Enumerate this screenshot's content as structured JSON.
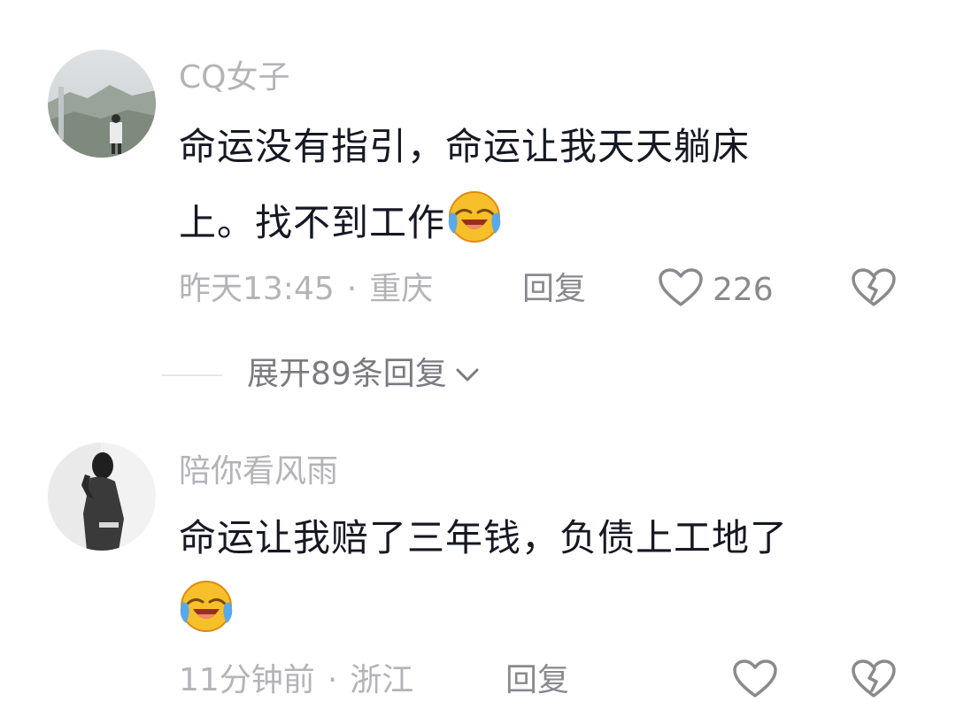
{
  "comments": [
    {
      "username": "CQ女子",
      "text_lines": [
        "命运没有指引，命运让我天天躺床",
        "上。找不到工作"
      ],
      "time": "昨天13:45",
      "location": "重庆",
      "reply_label": "回复",
      "like_count": "226",
      "emoji": "laugh-cry"
    },
    {
      "username": "陪你看风雨",
      "text_lines": [
        "命运让我赔了三年钱，负债上工地了",
        ""
      ],
      "time": "11分钟前",
      "location": "浙江",
      "reply_label": "回复",
      "like_count": "",
      "emoji": "laugh-cry"
    }
  ],
  "expand_replies": {
    "label": "展开89条回复"
  },
  "separator": "·",
  "icons": {
    "like": "heart-outline-icon",
    "dislike": "broken-heart-icon",
    "expand": "chevron-down-icon"
  },
  "colors": {
    "text": "#161823",
    "secondary": "#b4b4b8",
    "action": "#8a8a8e"
  }
}
